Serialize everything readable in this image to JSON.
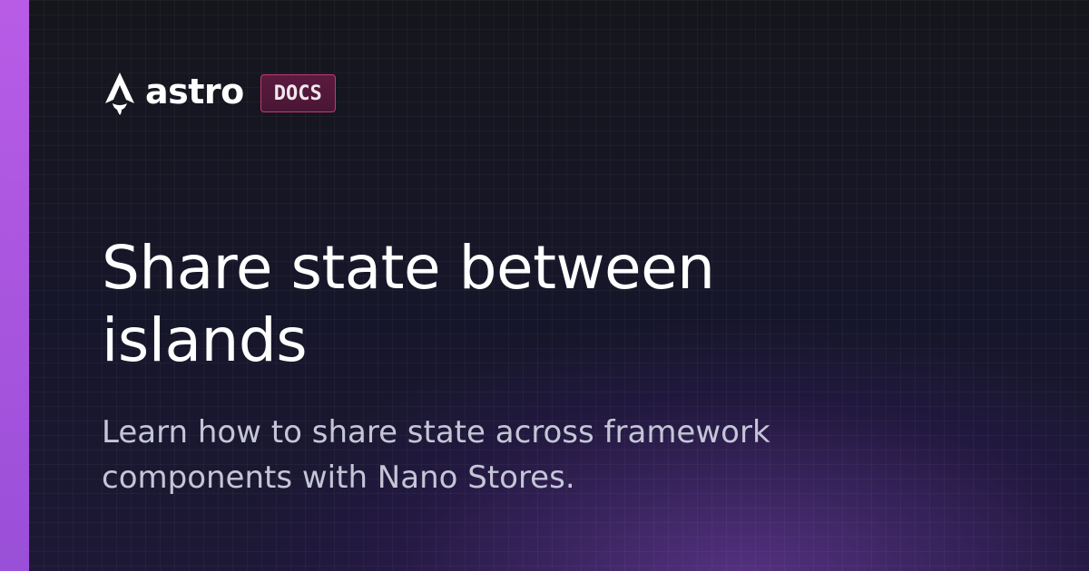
{
  "colors": {
    "accent_bar": "#b85ce6",
    "accent_bar_end": "#9a4fd8",
    "background": "#15161c",
    "glow": "#8246be",
    "badge_border": "#c33a72",
    "badge_bg": "#5b1a3f",
    "title": "#ffffff",
    "subtitle": "#c4c6d6"
  },
  "brand": {
    "logo_icon": "astro-rocket-icon",
    "wordmark": "astro",
    "badge": "DOCS"
  },
  "heading": {
    "line1": "Share state between",
    "line2": "islands"
  },
  "description": {
    "line1": "Learn how to share state across framework",
    "line2": "components with Nano Stores."
  }
}
